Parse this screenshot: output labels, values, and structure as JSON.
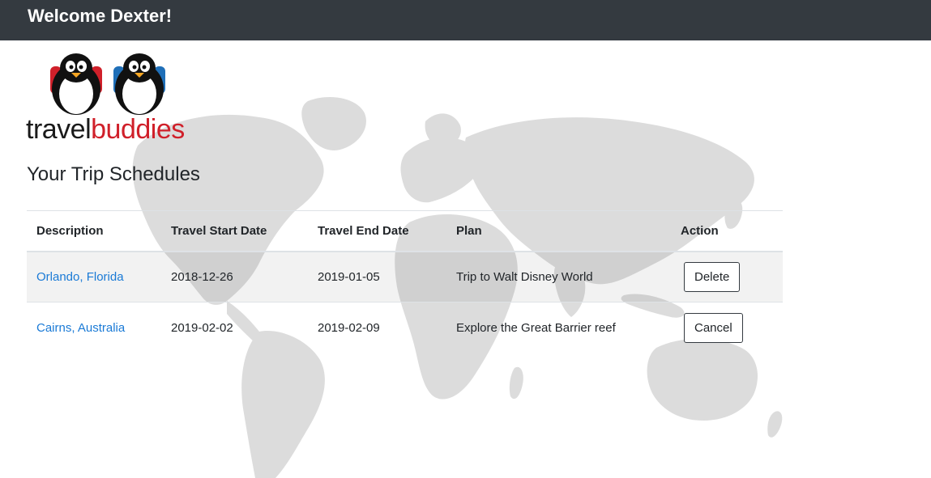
{
  "header": {
    "welcome": "Welcome Dexter!"
  },
  "logo": {
    "text_part1": "travel",
    "text_part2": "buddies",
    "icon": "two-penguins-with-backpacks"
  },
  "page": {
    "heading": "Your Trip Schedules"
  },
  "table": {
    "headers": [
      "Description",
      "Travel Start Date",
      "Travel End Date",
      "Plan",
      "Action"
    ],
    "rows": [
      {
        "description": "Orlando, Florida",
        "start": "2018-12-26",
        "end": "2019-01-05",
        "plan": "Trip to Walt Disney World",
        "action": "Delete"
      },
      {
        "description": "Cairns, Australia",
        "start": "2019-02-02",
        "end": "2019-02-09",
        "plan": "Explore the Great Barrier reef",
        "action": "Cancel"
      }
    ]
  },
  "colors": {
    "topbar": "#343a40",
    "link": "#1a7ad6",
    "brand_red": "#d0202a",
    "map": "#dcdcdc"
  }
}
